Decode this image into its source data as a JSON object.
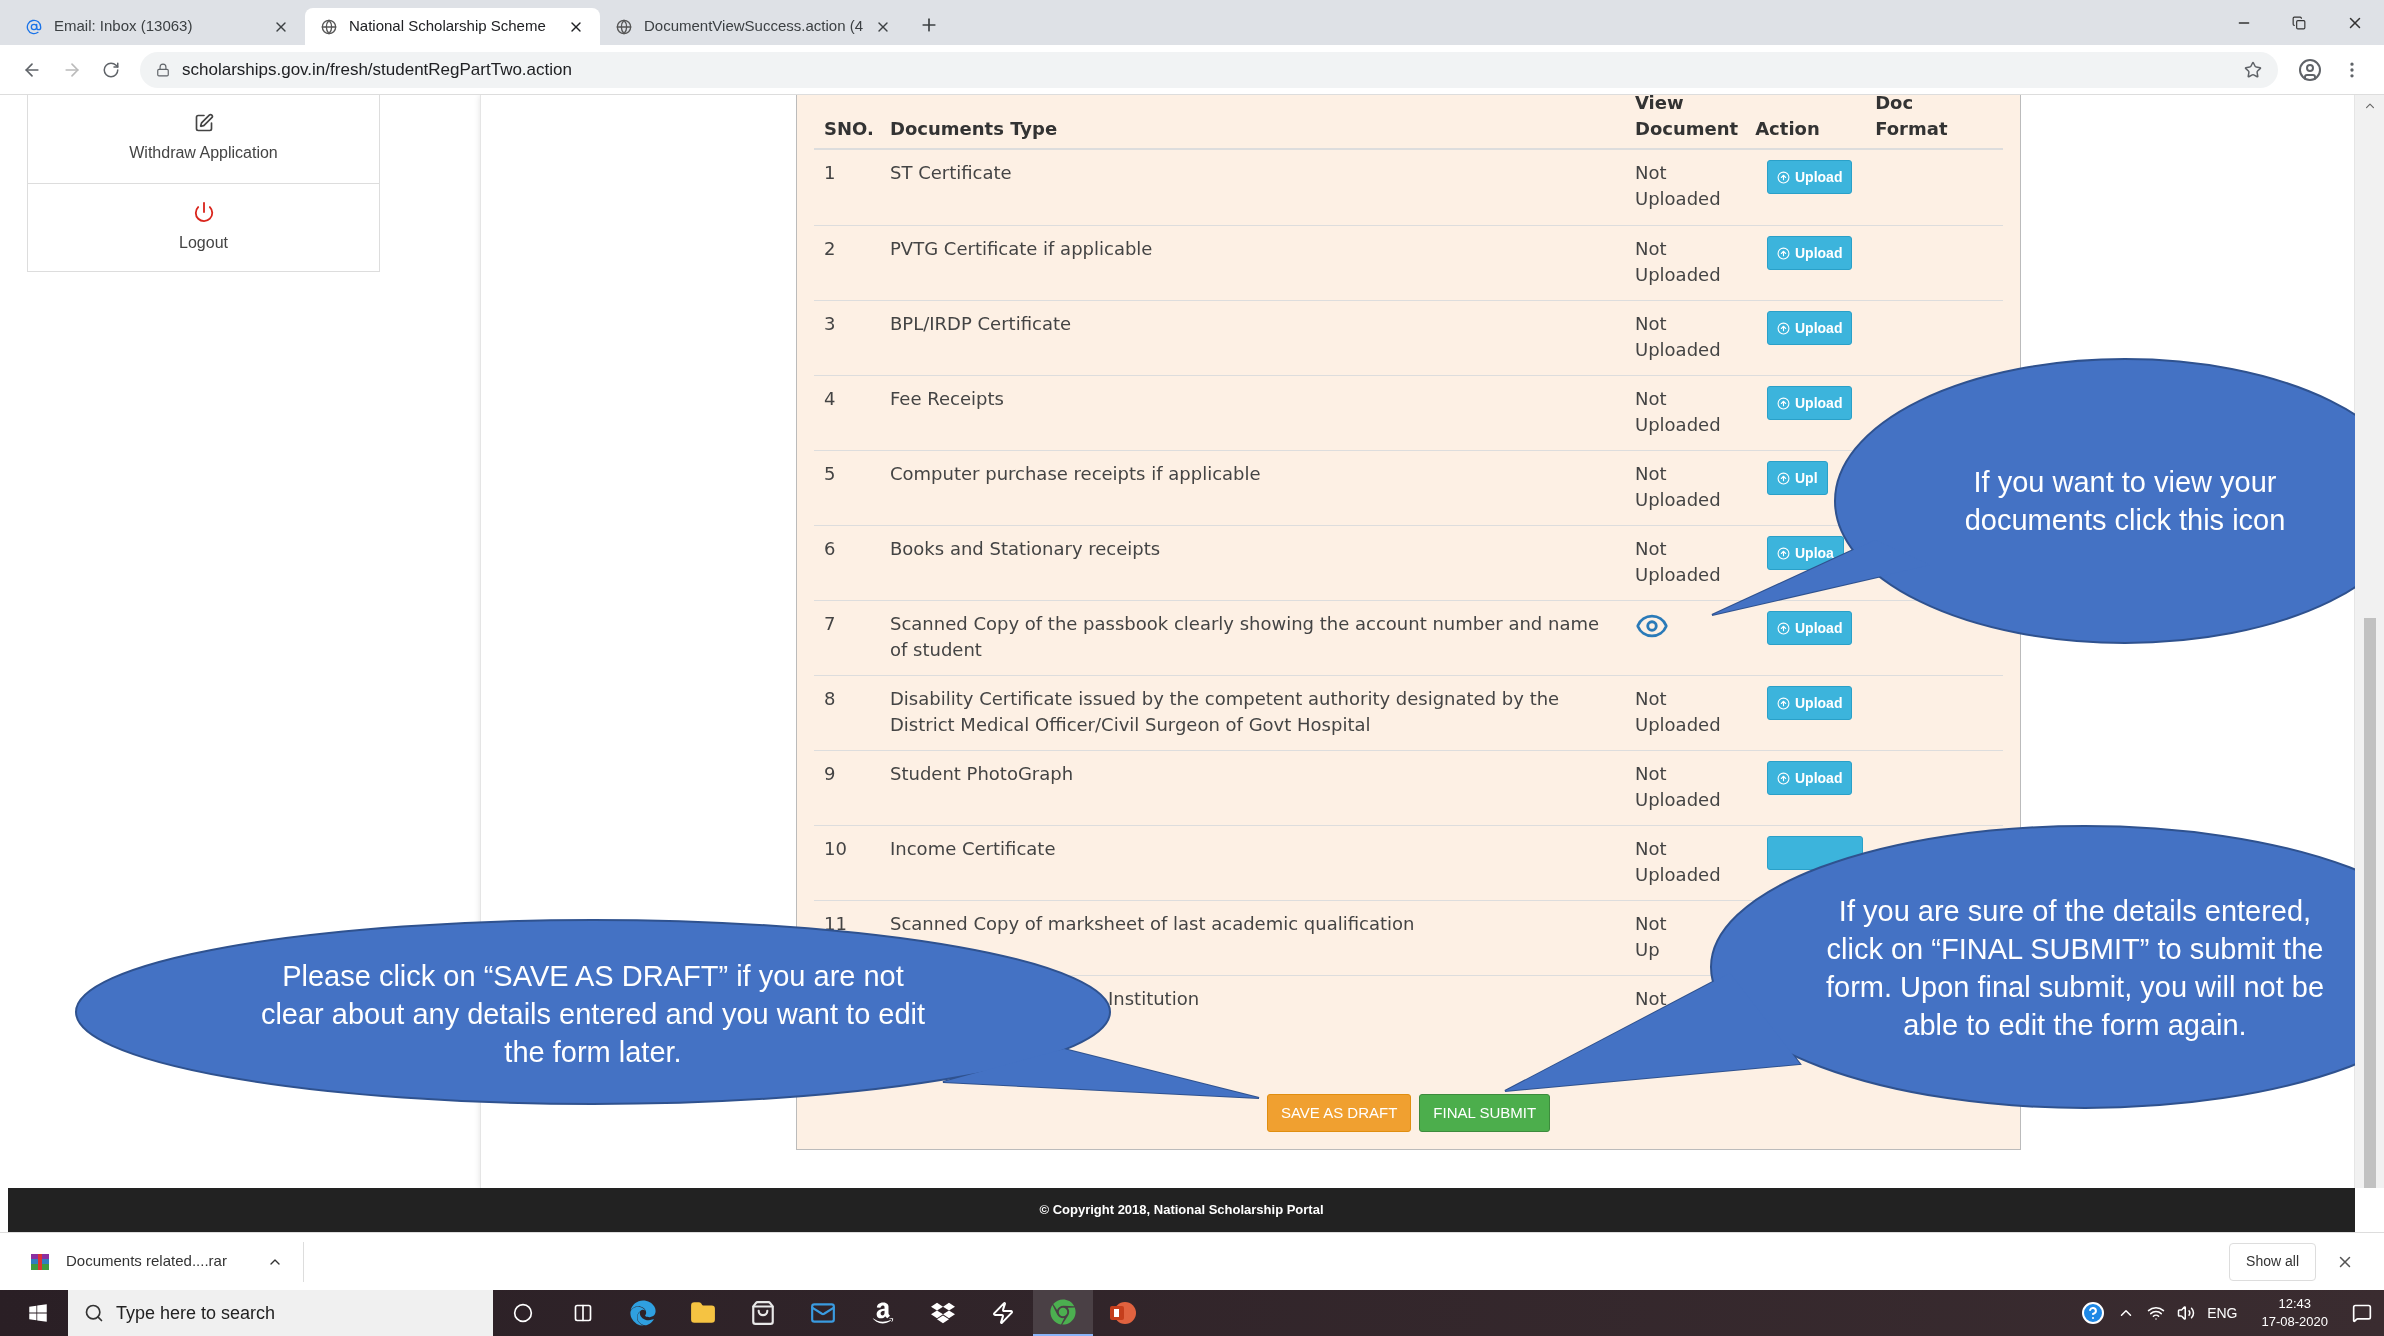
{
  "browser": {
    "tabs": [
      {
        "title": "Email: Inbox (13063)",
        "kind": "email",
        "selected": false
      },
      {
        "title": "National Scholarship Scheme",
        "kind": "globe",
        "selected": true
      },
      {
        "title": "DocumentViewSuccess.action (4",
        "kind": "globe",
        "selected": false
      }
    ],
    "address": "scholarships.gov.in/fresh/studentRegPartTwo.action"
  },
  "sidebar": {
    "items": [
      {
        "label": "Withdraw Application",
        "kind": "edit"
      },
      {
        "label": "Logout",
        "kind": "power"
      }
    ]
  },
  "table": {
    "columns": [
      "SNO.",
      "Documents Type",
      "View Document",
      "Action",
      "Doc Format"
    ],
    "rows": [
      {
        "sno": "1",
        "type": "ST Certificate",
        "view": {
          "kind": "text",
          "text": "Not Uploaded"
        },
        "action": {
          "kind": "upload",
          "label": "Upload"
        }
      },
      {
        "sno": "2",
        "type": "PVTG Certificate if applicable",
        "view": {
          "kind": "text",
          "text": "Not Uploaded"
        },
        "action": {
          "kind": "upload",
          "label": "Upload"
        }
      },
      {
        "sno": "3",
        "type": "BPL/IRDP Certificate",
        "view": {
          "kind": "text",
          "text": "Not Uploaded"
        },
        "action": {
          "kind": "upload",
          "label": "Upload"
        }
      },
      {
        "sno": "4",
        "type": "Fee Receipts",
        "view": {
          "kind": "text",
          "text": "Not Uploaded"
        },
        "action": {
          "kind": "upload",
          "label": "Upload"
        }
      },
      {
        "sno": "5",
        "type": "Computer purchase receipts if applicable",
        "view": {
          "kind": "text",
          "text": "Not Uploaded"
        },
        "action": {
          "kind": "upload",
          "label": "Upl"
        }
      },
      {
        "sno": "6",
        "type": "Books and Stationary receipts",
        "view": {
          "kind": "text",
          "text": "Not Uploaded"
        },
        "action": {
          "kind": "upload",
          "label": "Uploa"
        }
      },
      {
        "sno": "7",
        "type": "Scanned Copy of the passbook clearly showing the account number and name of student",
        "view": {
          "kind": "eye"
        },
        "action": {
          "kind": "upload",
          "label": "Upload"
        }
      },
      {
        "sno": "8",
        "type": "Disability Certificate issued by the competent authority designated by the District Medical Officer/Civil Surgeon of Govt Hospital",
        "view": {
          "kind": "text",
          "text": "Not Uploaded"
        },
        "action": {
          "kind": "upload",
          "label": "Upload"
        }
      },
      {
        "sno": "9",
        "type": "Student PhotoGraph",
        "view": {
          "kind": "text",
          "text": "Not Uploaded"
        },
        "action": {
          "kind": "upload",
          "label": "Upload"
        }
      },
      {
        "sno": "10",
        "type": "Income Certificate",
        "view": {
          "kind": "text",
          "text": "Not Uploaded"
        },
        "action": {
          "kind": "covered"
        }
      },
      {
        "sno": "11",
        "type": "Scanned Copy of marksheet of last academic qualification",
        "view": {
          "kind": "text",
          "text": "Not Up"
        }
      },
      {
        "type": "Institution",
        "covered": true,
        "view": {
          "kind": "text",
          "text": "Not"
        }
      }
    ]
  },
  "buttons": [
    {
      "label": "SAVE AS DRAFT",
      "kind": "draft"
    },
    {
      "label": "FINAL SUBMIT",
      "kind": "submit"
    }
  ],
  "callouts": [
    {
      "text": "If you want to view your documents click this icon"
    },
    {
      "text": "If you are sure of the details entered, click on “FINAL SUBMIT” to submit the form. Upon final submit, you will not be able to edit the form again."
    },
    {
      "text": "Please click on “SAVE AS DRAFT” if you are not clear about any details entered and you want to edit the form later."
    }
  ],
  "footer": "© Copyright 2018, National Scholarship Portal",
  "downloads": {
    "file": "Documents related....rar",
    "show_all": "Show all"
  },
  "taskbar": {
    "search_placeholder": "Type here to search",
    "apps": [
      {
        "kind": "cortana",
        "selected": false
      },
      {
        "kind": "taskview",
        "selected": false
      },
      {
        "kind": "edge",
        "selected": false
      },
      {
        "kind": "folder",
        "selected": false
      },
      {
        "kind": "store",
        "selected": false
      },
      {
        "kind": "mail",
        "selected": false
      },
      {
        "kind": "amazon",
        "selected": false
      },
      {
        "kind": "dropbox",
        "selected": false
      },
      {
        "kind": "bolt",
        "selected": false
      },
      {
        "kind": "chrome",
        "selected": true
      },
      {
        "kind": "powerpoint",
        "selected": false
      }
    ],
    "language": "ENG",
    "time": "12:43",
    "date": "17-08-2020"
  }
}
